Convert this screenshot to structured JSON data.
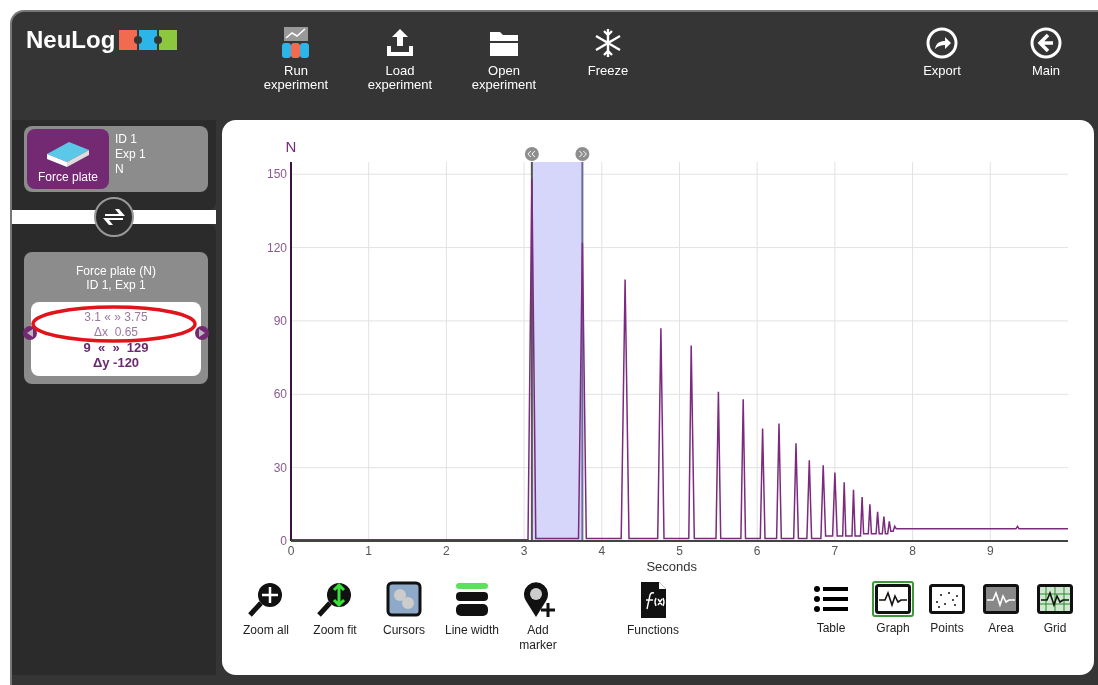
{
  "app": {
    "logo": "NeuLog"
  },
  "toolbar": [
    {
      "kind": "run",
      "label": "Run experiment"
    },
    {
      "kind": "load",
      "label": "Load experiment"
    },
    {
      "kind": "open",
      "label": "Open experiment"
    },
    {
      "kind": "freeze",
      "label": "Freeze"
    },
    {
      "kind": "export",
      "label": "Export"
    },
    {
      "kind": "main",
      "label": "Main"
    }
  ],
  "sensor": {
    "name": "Force plate",
    "lines": [
      "ID 1",
      "Exp 1",
      "N"
    ]
  },
  "readout": {
    "title": "Force plate (N)",
    "subtitle": "ID 1, Exp 1",
    "x_range": "3.1 « » 3.75",
    "dx": "Δx  0.65",
    "y_range": "9  «  »  129",
    "dy": "Δy -120"
  },
  "chart_data": {
    "type": "line",
    "xlabel": "Seconds",
    "ylabel": "N",
    "xlim": [
      0,
      10
    ],
    "ylim": [
      0,
      155
    ],
    "xticks": [
      0,
      1,
      2,
      3,
      4,
      5,
      6,
      7,
      8,
      9
    ],
    "yticks": [
      0,
      30,
      60,
      90,
      120,
      150
    ],
    "x": [
      0,
      3.05,
      3.1,
      3.15,
      3.7,
      3.75,
      3.8,
      4.25,
      4.3,
      4.35,
      4.72,
      4.76,
      4.8,
      5.12,
      5.15,
      5.19,
      5.47,
      5.5,
      5.53,
      5.79,
      5.82,
      5.85,
      6.04,
      6.07,
      6.1,
      6.25,
      6.28,
      6.31,
      6.47,
      6.5,
      6.53,
      6.64,
      6.67,
      6.7,
      6.82,
      6.85,
      6.88,
      6.97,
      7.0,
      7.03,
      7.1,
      7.12,
      7.14,
      7.22,
      7.24,
      7.26,
      7.33,
      7.35,
      7.37,
      7.43,
      7.45,
      7.47,
      7.53,
      7.55,
      7.57,
      7.61,
      7.63,
      7.65,
      7.68,
      7.7,
      7.72,
      7.75,
      7.77,
      7.79,
      7.9,
      9.33,
      9.35,
      9.37,
      10
    ],
    "series": [
      {
        "color": "#7b2a7e",
        "values": [
          0.5,
          0.5,
          148,
          1,
          1,
          122,
          1,
          1,
          107,
          1,
          1,
          87,
          1,
          1,
          80,
          1,
          1,
          61,
          1,
          1,
          58,
          1,
          1,
          46,
          1,
          1,
          48,
          1,
          1,
          40,
          1,
          1,
          33,
          1,
          1,
          31,
          2,
          2,
          28,
          2,
          2,
          24,
          2,
          2,
          21,
          2,
          2,
          18,
          3,
          3,
          15,
          3,
          3,
          12,
          3,
          3,
          10,
          3,
          3,
          8,
          4,
          4,
          6,
          5,
          5,
          5,
          6,
          5,
          5
        ]
      }
    ],
    "grid": true,
    "bands": [
      {
        "axis": "x",
        "from": 3.1,
        "to": 3.75,
        "color": "#d6d6fa"
      }
    ],
    "ref_lines": [
      {
        "axis": "x",
        "value": 3.1,
        "color": "#555555"
      },
      {
        "axis": "x",
        "value": 3.75,
        "color": "#6a6a9a"
      }
    ]
  },
  "tools": [
    {
      "kind": "zoomall",
      "label": "Zoom all"
    },
    {
      "kind": "zoomfit",
      "label": "Zoom fit"
    },
    {
      "kind": "cursors",
      "label": "Cursors"
    },
    {
      "kind": "linewidth",
      "label": "Line width"
    },
    {
      "kind": "marker",
      "label": "Add marker"
    },
    {
      "kind": "functions",
      "label": "Functions"
    }
  ],
  "views": [
    {
      "kind": "table",
      "label": "Table",
      "selected": false
    },
    {
      "kind": "graph",
      "label": "Graph",
      "selected": true
    },
    {
      "kind": "points",
      "label": "Points",
      "selected": false
    },
    {
      "kind": "area",
      "label": "Area",
      "selected": false
    },
    {
      "kind": "grid",
      "label": "Grid",
      "selected": false
    }
  ]
}
